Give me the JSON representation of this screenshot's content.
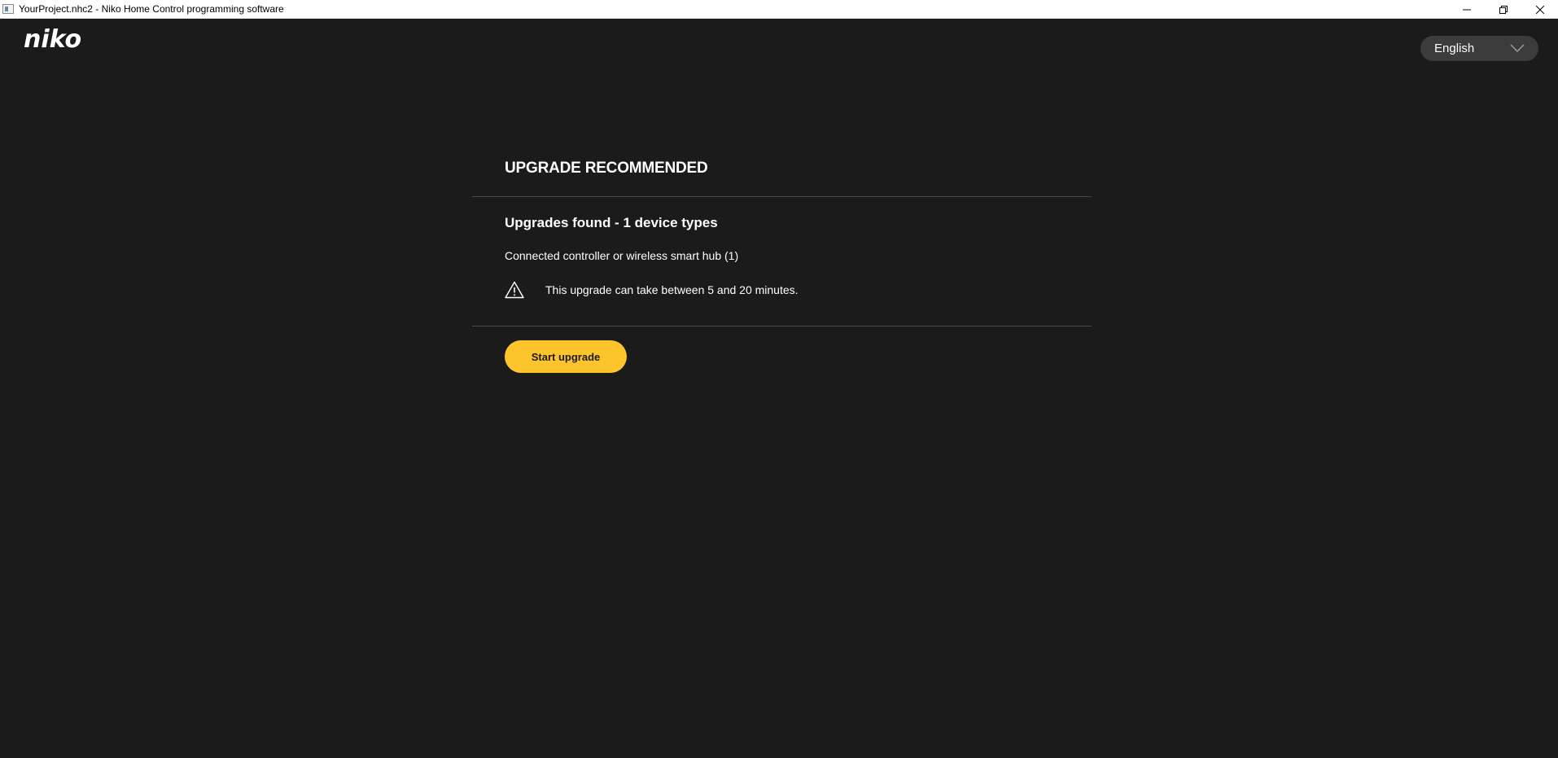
{
  "window": {
    "title": "YourProject.nhc2 - Niko Home Control programming software",
    "controls": [
      "minimize-icon",
      "restore-icon",
      "close-icon"
    ]
  },
  "header": {
    "logo_text": "niko",
    "language": {
      "selected": "English",
      "icon": "chevron-down-icon"
    }
  },
  "upgrade": {
    "title": "UPGRADE RECOMMENDED",
    "heading": "Upgrades found - 1 device types",
    "devices": [
      "Connected controller or wireless smart hub (1)"
    ],
    "warning": {
      "icon": "warning-triangle-icon",
      "text": "This upgrade can take between 5 and 20 minutes."
    },
    "start_button_label": "Start upgrade"
  },
  "colors": {
    "background": "#1b1b1b",
    "accent": "#fdc42c",
    "divider": "#4a4a4a",
    "select_background": "#3c3c3c"
  }
}
